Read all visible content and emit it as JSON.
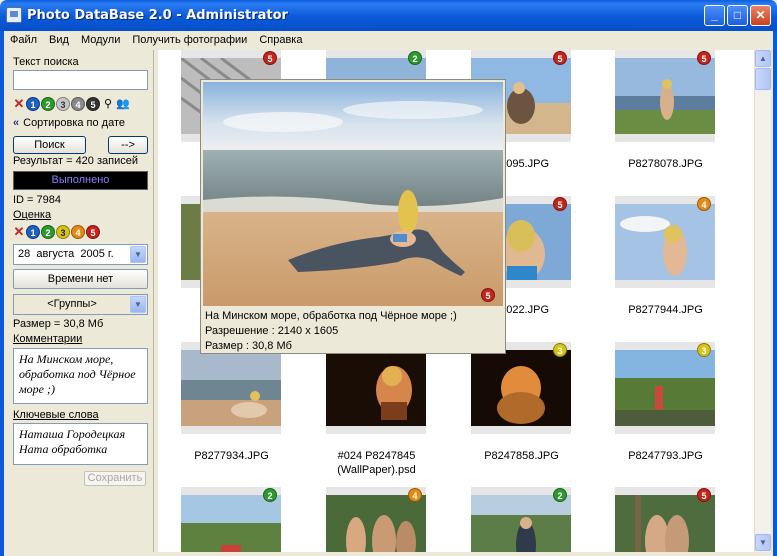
{
  "window": {
    "title": "Photo DataBase 2.0 - Administrator",
    "minimize": "_",
    "maximize": "□",
    "close": "✕"
  },
  "menu": [
    "Файл",
    "Вид",
    "Модули",
    "Получить фотографии",
    "Справка"
  ],
  "search": {
    "label": "Текст поиска",
    "value": "",
    "rating_filters": [
      "1",
      "2",
      "3",
      "4",
      "5"
    ],
    "sort_label": "Сортировка по дате",
    "search_button": "Поиск",
    "next_button": "-->",
    "result_text": "Результат = 420 записей",
    "status_text": "Выполнено"
  },
  "details": {
    "id_text": "ID = 7984",
    "rating_label": "Оценка",
    "rating_values": [
      "1",
      "2",
      "3",
      "4",
      "5"
    ],
    "date_day": "28",
    "date_month": "августа",
    "date_year": "2005 г.",
    "time_button": "Времени нет",
    "groups_value": "<Группы>",
    "size_text": "Размер = 30,8 Мб",
    "comments_label": "Комментарии",
    "comments_value": "На Минском море, обработка под Чёрное море ;)",
    "keywords_label": "Ключевые слова",
    "keywords_value": "Наташа Городецкая\nНата обработка",
    "save_button": "Сохранить"
  },
  "thumbnails": [
    {
      "caption": "#",
      "caption2": "\\",
      "rating": "5",
      "badge_color": "#c3241b",
      "img": "hatch"
    },
    {
      "caption": "",
      "rating": "2",
      "badge_color": "#2e9a2e",
      "img": "sky"
    },
    {
      "caption": "78095.JPG",
      "rating": "5",
      "badge_color": "#c3241b",
      "img": "beach1"
    },
    {
      "caption": "P8278078.JPG",
      "rating": "5",
      "badge_color": "#c3241b",
      "img": "lake1"
    },
    {
      "caption": "P",
      "rating": "",
      "badge_color": "",
      "img": "grass"
    },
    {
      "caption": "",
      "rating": "",
      "badge_color": "",
      "img": "none"
    },
    {
      "caption": "78022.JPG",
      "rating": "5",
      "badge_color": "#c3241b",
      "img": "portrait"
    },
    {
      "caption": "P8277944.JPG",
      "rating": "4",
      "badge_color": "#e58b14",
      "img": "sky2"
    },
    {
      "caption": "P8277934.JPG",
      "rating": "",
      "badge_color": "",
      "img": "sea"
    },
    {
      "caption": "#024 P8247845\n(WallPaper).psd",
      "rating": "",
      "badge_color": "",
      "img": "dark"
    },
    {
      "caption": "P8247858.JPG",
      "rating": "3",
      "badge_color": "#d9c217",
      "img": "dark2"
    },
    {
      "caption": "P8247793.JPG",
      "rating": "3",
      "badge_color": "#d9c217",
      "img": "forest"
    },
    {
      "caption": "",
      "rating": "2",
      "badge_color": "#2e9a2e",
      "img": "forest2"
    },
    {
      "caption": "",
      "rating": "4",
      "badge_color": "#e58b14",
      "img": "group"
    },
    {
      "caption": "",
      "rating": "2",
      "badge_color": "#2e9a2e",
      "img": "forest3"
    },
    {
      "caption": "",
      "rating": "5",
      "badge_color": "#c3241b",
      "img": "forest4"
    }
  ],
  "popup": {
    "comment": "На Минском море, обработка под Чёрное море ;)",
    "resolution": "Разрешение : 2140 x 1605",
    "size": "Размер : 30,8 Мб",
    "rating": "5"
  }
}
